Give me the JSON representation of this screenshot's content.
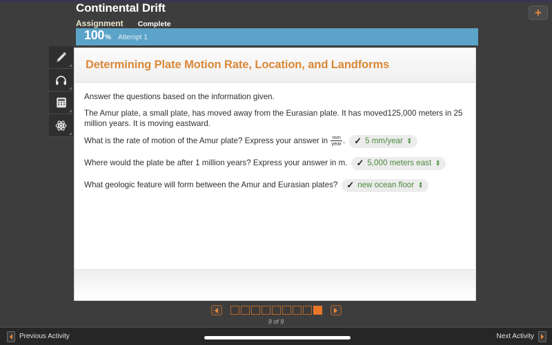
{
  "header": {
    "title": "Continental Drift",
    "category": "Assignment",
    "status": "Complete",
    "add_button_icon": "plus-icon"
  },
  "score": {
    "percent": "100",
    "percent_symbol": "%",
    "attempt": "Attempt 1",
    "bar_color": "#5ba3c9"
  },
  "toolbar": {
    "items": [
      {
        "icon": "pencil-icon",
        "name": "annotate-tool"
      },
      {
        "icon": "headphones-icon",
        "name": "audio-tool"
      },
      {
        "icon": "calculator-icon",
        "name": "calculator-tool"
      },
      {
        "icon": "atom-icon",
        "name": "periodic-table-tool"
      }
    ]
  },
  "card": {
    "title": "Determining Plate Motion Rate, Location, and Landforms",
    "title_color": "#d98838",
    "intro": "Answer the questions based on the information given.",
    "passage": "The Amur plate, a small plate, has moved away from the Eurasian plate. It has moved125,000 meters in 25 million years. It is moving eastward.",
    "questions": [
      {
        "prompt_before": "What is the rate of motion of the Amur plate? Express your answer in ",
        "fraction_numerator": "mm",
        "fraction_denominator": "year",
        "prompt_after": ".",
        "answer": "5 mm/year",
        "correct_mark": "✓",
        "answer_color": "#4a8a3c"
      },
      {
        "prompt_before": "Where would the plate be after 1 million years? Express your answer in m.",
        "fraction_numerator": "",
        "fraction_denominator": "",
        "prompt_after": "",
        "answer": "5,000 meters east",
        "correct_mark": "✓",
        "answer_color": "#4a8a3c"
      },
      {
        "prompt_before": "What geologic feature will form between the Amur and Eurasian plates?",
        "fraction_numerator": "",
        "fraction_denominator": "",
        "prompt_after": "",
        "answer": "new ocean floor",
        "correct_mark": "✓",
        "answer_color": "#4a8a3c"
      }
    ]
  },
  "pager": {
    "prev_icon": "triangle-left-icon",
    "next_icon": "triangle-right-icon",
    "total_pages": 9,
    "current_page": 9,
    "label": "9 of 9",
    "active_color": "#e8772a"
  },
  "bottom_bar": {
    "previous_label": "Previous Activity",
    "next_label": "Next Activity",
    "previous_icon": "triangle-left-icon",
    "next_icon": "triangle-right-icon"
  }
}
